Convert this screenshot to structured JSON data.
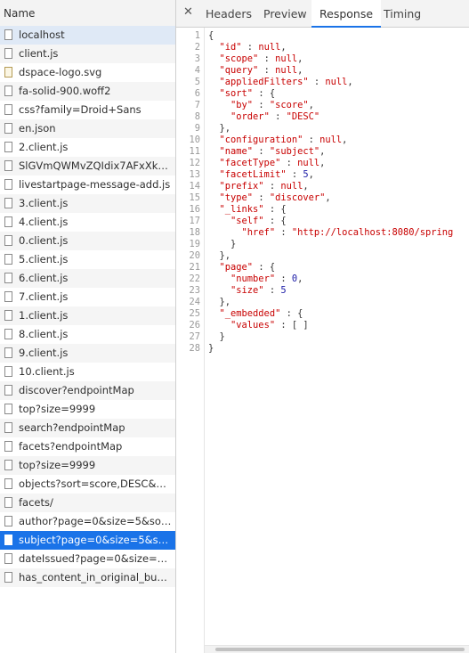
{
  "name_header": "Name",
  "requests": [
    {
      "label": "localhost",
      "icon": "file-icon"
    },
    {
      "label": "client.js",
      "icon": "file-icon"
    },
    {
      "label": "dspace-logo.svg",
      "icon": "image-file-icon"
    },
    {
      "label": "fa-solid-900.woff2",
      "icon": "file-icon"
    },
    {
      "label": "css?family=Droid+Sans",
      "icon": "file-icon"
    },
    {
      "label": "en.json",
      "icon": "file-icon"
    },
    {
      "label": "2.client.js",
      "icon": "file-icon"
    },
    {
      "label": "SlGVmQWMvZQIdix7AFxXkH...",
      "icon": "file-icon"
    },
    {
      "label": "livestartpage-message-add.js",
      "icon": "file-icon"
    },
    {
      "label": "3.client.js",
      "icon": "file-icon"
    },
    {
      "label": "4.client.js",
      "icon": "file-icon"
    },
    {
      "label": "0.client.js",
      "icon": "file-icon"
    },
    {
      "label": "5.client.js",
      "icon": "file-icon"
    },
    {
      "label": "6.client.js",
      "icon": "file-icon"
    },
    {
      "label": "7.client.js",
      "icon": "file-icon"
    },
    {
      "label": "1.client.js",
      "icon": "file-icon"
    },
    {
      "label": "8.client.js",
      "icon": "file-icon"
    },
    {
      "label": "9.client.js",
      "icon": "file-icon"
    },
    {
      "label": "10.client.js",
      "icon": "file-icon"
    },
    {
      "label": "discover?endpointMap",
      "icon": "file-icon"
    },
    {
      "label": "top?size=9999",
      "icon": "file-icon"
    },
    {
      "label": "search?endpointMap",
      "icon": "file-icon"
    },
    {
      "label": "facets?endpointMap",
      "icon": "file-icon"
    },
    {
      "label": "top?size=9999",
      "icon": "file-icon"
    },
    {
      "label": "objects?sort=score,DESC&pa...",
      "icon": "file-icon"
    },
    {
      "label": "facets/",
      "icon": "file-icon"
    },
    {
      "label": "author?page=0&size=5&sort...",
      "icon": "file-icon"
    },
    {
      "label": "subject?page=0&size=5&sort...",
      "icon": "file-icon"
    },
    {
      "label": "dateIssued?page=0&size=5&...",
      "icon": "file-icon"
    },
    {
      "label": "has_content_in_original_bun...",
      "icon": "file-icon"
    }
  ],
  "selected_request_index": 27,
  "tabs": {
    "close_icon": "close-icon",
    "headers": "Headers",
    "preview": "Preview",
    "response": "Response",
    "timing": "Timing",
    "active": "Response"
  },
  "response_lines": [
    "{",
    "  \"id\" : null,",
    "  \"scope\" : null,",
    "  \"query\" : null,",
    "  \"appliedFilters\" : null,",
    "  \"sort\" : {",
    "    \"by\" : \"score\",",
    "    \"order\" : \"DESC\"",
    "  },",
    "  \"configuration\" : null,",
    "  \"name\" : \"subject\",",
    "  \"facetType\" : null,",
    "  \"facetLimit\" : 5,",
    "  \"prefix\" : null,",
    "  \"type\" : \"discover\",",
    "  \"_links\" : {",
    "    \"self\" : {",
    "      \"href\" : \"http://localhost:8080/spring",
    "    }",
    "  },",
    "  \"page\" : {",
    "    \"number\" : 0,",
    "    \"size\" : 5",
    "  },",
    "  \"_embedded\" : {",
    "    \"values\" : [ ]",
    "  }",
    "}"
  ]
}
